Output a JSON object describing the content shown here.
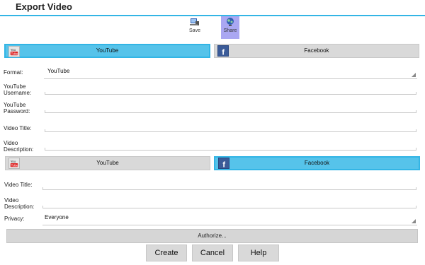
{
  "window": {
    "title": "Export Video"
  },
  "toolbar": {
    "save_label": "Save",
    "share_label": "Share"
  },
  "tabs_top": [
    {
      "label": "YouTube",
      "icon": "youtube-logo-icon"
    },
    {
      "label": "Facebook",
      "icon": "facebook-logo-icon"
    }
  ],
  "tabs_mid": [
    {
      "label": "YouTube",
      "icon": "youtube-logo-icon"
    },
    {
      "label": "Facebook",
      "icon": "facebook-logo-icon"
    }
  ],
  "youtube": {
    "format_label": "Format:",
    "format_value": "YouTube",
    "username_label_1": "YouTube",
    "username_label_2": "Username:",
    "password_label_1": "YouTube",
    "password_label_2": "Password:",
    "title_label": "Video Title:",
    "desc_label_1": "Video",
    "desc_label_2": "Description:"
  },
  "facebook": {
    "title_label": "Video Title:",
    "desc_label_1": "Video",
    "desc_label_2": "Description:",
    "privacy_label": "Privacy:",
    "privacy_value": "Everyone",
    "authorize_label": "Authorize..."
  },
  "buttons": {
    "create": "Create",
    "cancel": "Cancel",
    "help": "Help"
  },
  "colors": {
    "accent": "#33b5e5",
    "active_tab": "#56c3ea",
    "share_highlight": "#aaa7f2"
  }
}
